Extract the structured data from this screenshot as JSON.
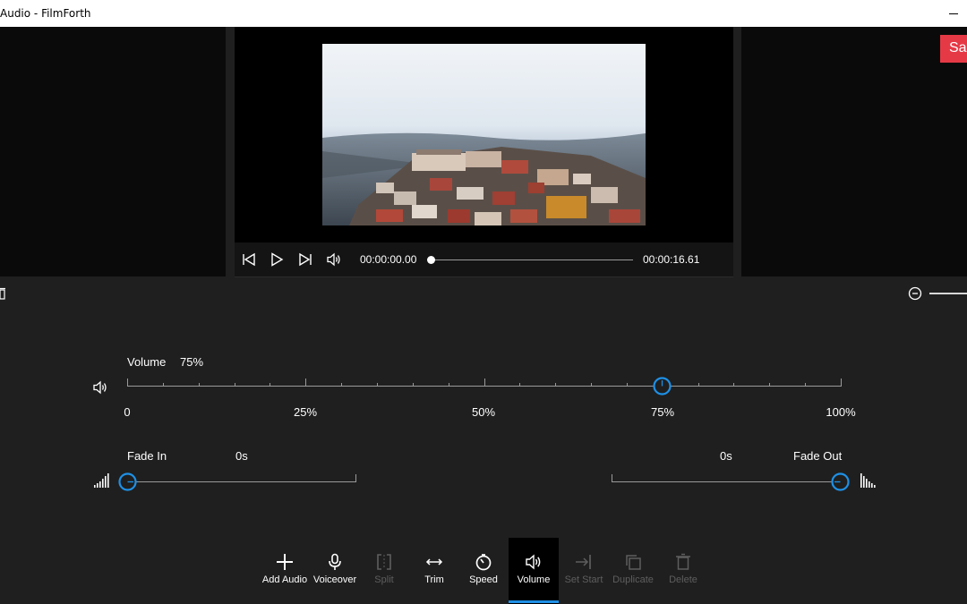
{
  "window": {
    "title": "Audio - FilmForth"
  },
  "preview": {
    "save_label": "Sa",
    "current_time": "00:00:00.00",
    "end_time": "00:00:16.61",
    "progress": 0
  },
  "volume": {
    "label": "Volume",
    "value_text": "75%",
    "value": 75,
    "tick_labels": [
      "0",
      "25%",
      "50%",
      "75%",
      "100%"
    ]
  },
  "fade": {
    "in_label": "Fade In",
    "in_value": "0s",
    "out_value": "0s",
    "out_label": "Fade Out"
  },
  "toolbar": {
    "items": [
      {
        "label": "Add Audio",
        "icon": "plus-icon",
        "enabled": true,
        "active": false
      },
      {
        "label": "Voiceover",
        "icon": "microphone-icon",
        "enabled": true,
        "active": false
      },
      {
        "label": "Split",
        "icon": "split-icon",
        "enabled": false,
        "active": false
      },
      {
        "label": "Trim",
        "icon": "trim-icon",
        "enabled": true,
        "active": false
      },
      {
        "label": "Speed",
        "icon": "speed-icon",
        "enabled": true,
        "active": false
      },
      {
        "label": "Volume",
        "icon": "speaker-icon",
        "enabled": true,
        "active": true
      },
      {
        "label": "Set Start",
        "icon": "set-start-icon",
        "enabled": false,
        "active": false
      },
      {
        "label": "Duplicate",
        "icon": "duplicate-icon",
        "enabled": false,
        "active": false
      },
      {
        "label": "Delete",
        "icon": "trash-icon",
        "enabled": false,
        "active": false
      }
    ]
  },
  "colors": {
    "accent": "#1e90e6",
    "save": "#e63946"
  }
}
